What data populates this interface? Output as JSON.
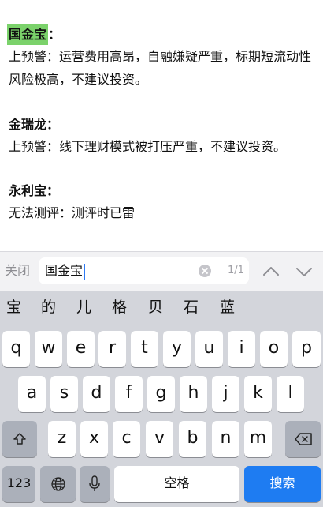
{
  "document": {
    "entries": [
      {
        "title": "国金宝",
        "colon": "：",
        "body": "上预警：运营费用高昂，自融嫌疑严重，标期短流动性风险极高，不建议投资。"
      },
      {
        "title": "金瑞龙",
        "colon": "：",
        "body": "上预警：线下理财模式被打压严重，不建议投资。"
      },
      {
        "title": "永利宝",
        "colon": "：",
        "body": "无法测评：测评时已雷"
      }
    ]
  },
  "find_bar": {
    "close_label": "关闭",
    "query": "国金宝",
    "match_count": "1/1"
  },
  "keyboard": {
    "candidates": [
      "宝",
      "的",
      "儿",
      "格",
      "贝",
      "石",
      "蓝"
    ],
    "row1": [
      "q",
      "w",
      "e",
      "r",
      "t",
      "y",
      "u",
      "i",
      "o",
      "p"
    ],
    "row2": [
      "a",
      "s",
      "d",
      "f",
      "g",
      "h",
      "j",
      "k",
      "l"
    ],
    "row3": [
      "z",
      "x",
      "c",
      "v",
      "b",
      "n",
      "m"
    ],
    "number_key": "123",
    "space_label": "空格",
    "search_label": "搜索"
  },
  "colors": {
    "highlight": "#7bd26b",
    "search_key": "#1e7cf2",
    "caret": "#2f7bf5"
  }
}
